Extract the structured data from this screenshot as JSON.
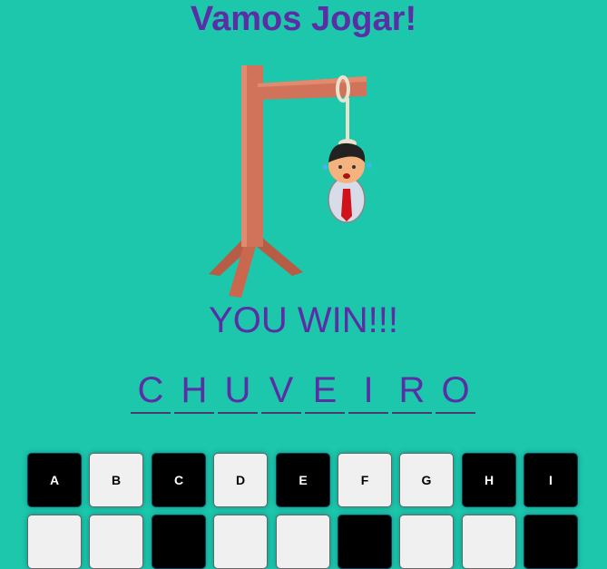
{
  "game": {
    "title": "Vamos Jogar!",
    "result": "YOU WIN!!!",
    "word": [
      "C",
      "H",
      "U",
      "V",
      "E",
      "I",
      "R",
      "O"
    ]
  },
  "keyboard": {
    "row1": [
      {
        "letter": "A",
        "used": true
      },
      {
        "letter": "B",
        "used": false
      },
      {
        "letter": "C",
        "used": true
      },
      {
        "letter": "D",
        "used": false
      },
      {
        "letter": "E",
        "used": true
      },
      {
        "letter": "F",
        "used": false
      },
      {
        "letter": "G",
        "used": false
      },
      {
        "letter": "H",
        "used": true
      },
      {
        "letter": "I",
        "used": true
      }
    ],
    "row2_partial": [
      false,
      false,
      true,
      false,
      false,
      true,
      false,
      false,
      true
    ]
  },
  "colors": {
    "background": "#1cc7ab",
    "text": "#5b2ea6",
    "used_key": "#000000",
    "open_key": "#f0f0f0"
  }
}
